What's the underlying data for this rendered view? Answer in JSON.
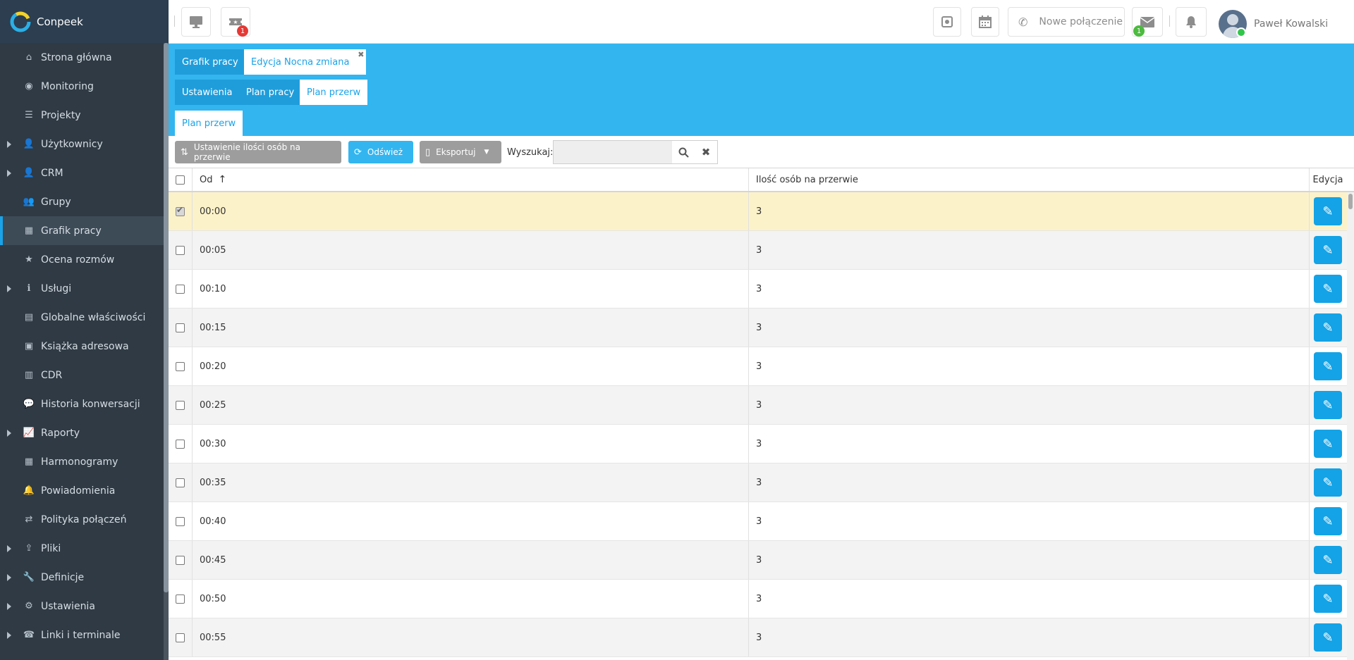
{
  "brand": {
    "name": "Conpeek"
  },
  "sidebar": {
    "items": [
      {
        "label": "Strona główna",
        "icon": "home-icon",
        "glyph": "⌂",
        "caret": false
      },
      {
        "label": "Monitoring",
        "icon": "eye-icon",
        "glyph": "◉",
        "caret": false
      },
      {
        "label": "Projekty",
        "icon": "list-icon",
        "glyph": "☰",
        "caret": false
      },
      {
        "label": "Użytkownicy",
        "icon": "user-icon",
        "glyph": "👤",
        "caret": true
      },
      {
        "label": "CRM",
        "icon": "user-icon",
        "glyph": "👤",
        "caret": true
      },
      {
        "label": "Grupy",
        "icon": "users-icon",
        "glyph": "👥",
        "caret": false
      },
      {
        "label": "Grafik pracy",
        "icon": "calendar-clock-icon",
        "glyph": "▦",
        "caret": false,
        "active": true
      },
      {
        "label": "Ocena rozmów",
        "icon": "star-icon",
        "glyph": "★",
        "caret": false
      },
      {
        "label": "Usługi",
        "icon": "info-icon",
        "glyph": "ℹ",
        "caret": true
      },
      {
        "label": "Globalne właściwości",
        "icon": "sign-icon",
        "glyph": "▤",
        "caret": false
      },
      {
        "label": "Książka adresowa",
        "icon": "address-card-icon",
        "glyph": "▣",
        "caret": false
      },
      {
        "label": "CDR",
        "icon": "bar-chart-icon",
        "glyph": "▥",
        "caret": false
      },
      {
        "label": "Historia konwersacji",
        "icon": "chat-icon",
        "glyph": "💬",
        "caret": false
      },
      {
        "label": "Raporty",
        "icon": "line-chart-icon",
        "glyph": "📈",
        "caret": true
      },
      {
        "label": "Harmonogramy",
        "icon": "calendar-icon",
        "glyph": "▦",
        "caret": false
      },
      {
        "label": "Powiadomienia",
        "icon": "bell-icon",
        "glyph": "🔔",
        "caret": false
      },
      {
        "label": "Polityka połączeń",
        "icon": "exchange-icon",
        "glyph": "⇄",
        "caret": false
      },
      {
        "label": "Pliki",
        "icon": "upload-icon",
        "glyph": "⇪",
        "caret": true
      },
      {
        "label": "Definicje",
        "icon": "wrench-icon",
        "glyph": "🔧",
        "caret": true
      },
      {
        "label": "Ustawienia",
        "icon": "gears-icon",
        "glyph": "⚙",
        "caret": true
      },
      {
        "label": "Linki i terminale",
        "icon": "terminal-icon",
        "glyph": "☎",
        "caret": true
      }
    ]
  },
  "topbar": {
    "ticket_badge": "1",
    "new_call_label": "Nowe połączenie",
    "mail_badge": "1",
    "user_name": "Paweł Kowalski"
  },
  "tabs": {
    "row1": [
      "Grafik pracy",
      "Edycja Nocna zmiana"
    ],
    "row2": [
      "Ustawienia",
      "Plan pracy",
      "Plan przerw"
    ],
    "row3": [
      "Plan przerw"
    ]
  },
  "toolbar": {
    "set_count_label": "Ustawienie ilości osób na przerwie",
    "refresh_label": "Odśwież",
    "export_label": "Eksportuj",
    "search_label": "Wyszukaj:",
    "search_value": ""
  },
  "table": {
    "headers": {
      "from": "Od",
      "count": "Ilość osób na przerwie",
      "edit": "Edycja"
    },
    "rows": [
      {
        "from": "00:00",
        "count": "3",
        "selected": true
      },
      {
        "from": "00:05",
        "count": "3"
      },
      {
        "from": "00:10",
        "count": "3"
      },
      {
        "from": "00:15",
        "count": "3"
      },
      {
        "from": "00:20",
        "count": "3"
      },
      {
        "from": "00:25",
        "count": "3"
      },
      {
        "from": "00:30",
        "count": "3"
      },
      {
        "from": "00:35",
        "count": "3"
      },
      {
        "from": "00:40",
        "count": "3"
      },
      {
        "from": "00:45",
        "count": "3"
      },
      {
        "from": "00:50",
        "count": "3"
      },
      {
        "from": "00:55",
        "count": "3"
      }
    ]
  },
  "colors": {
    "accent": "#33b5f0",
    "sidebar": "#2f3a44",
    "selected_row": "#fcf2c9",
    "edit_button": "#13a3e6"
  }
}
